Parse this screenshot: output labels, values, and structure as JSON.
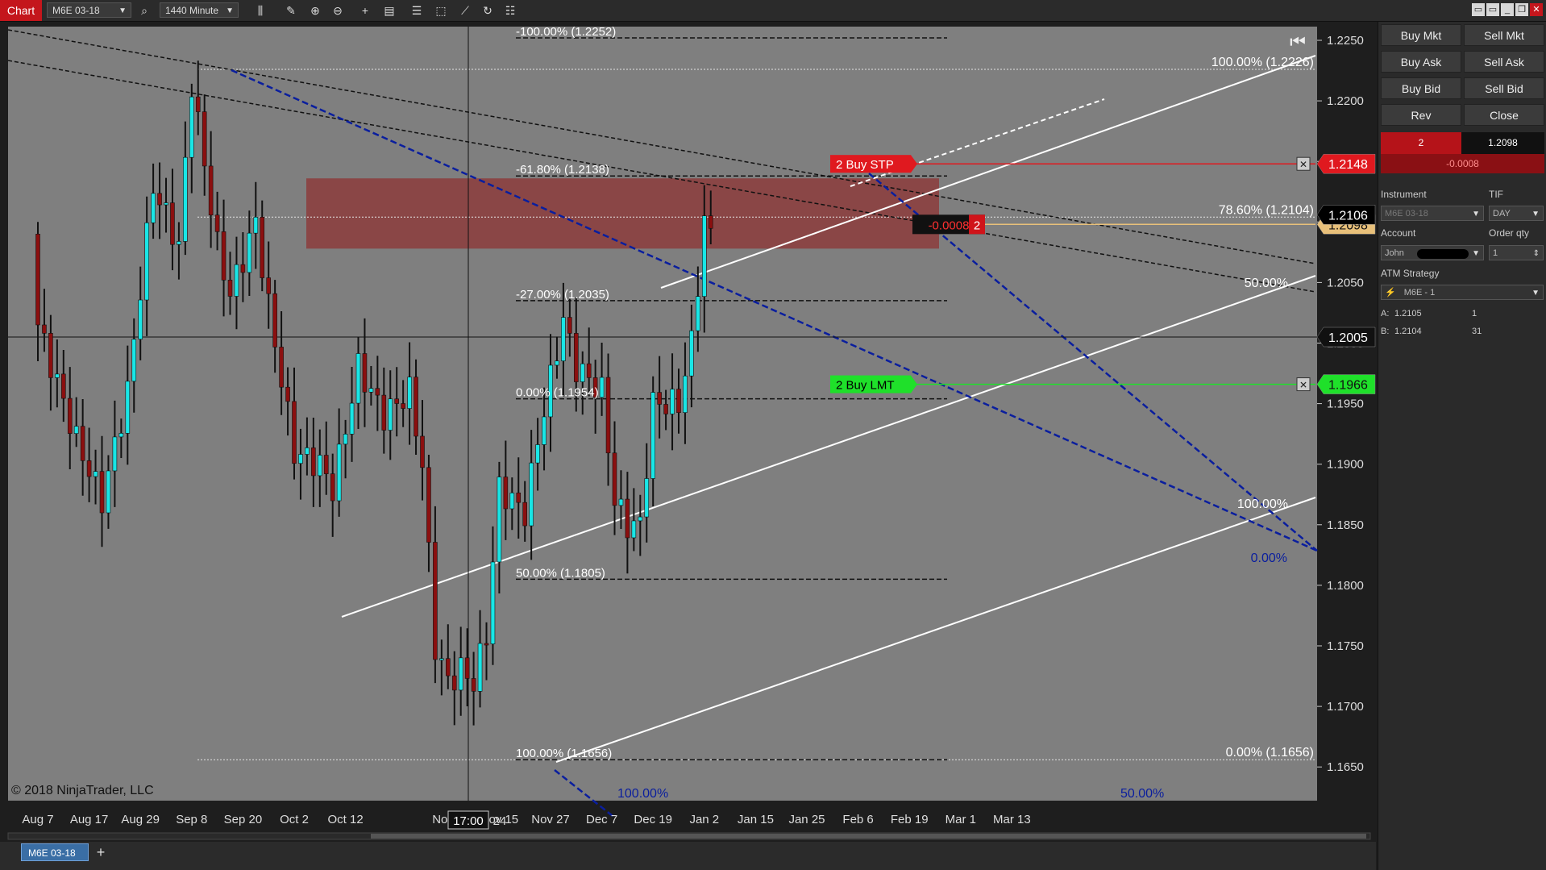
{
  "toolbar": {
    "chart_tab": "Chart",
    "instrument": "M6E 03-18",
    "interval": "1440 Minute"
  },
  "chart": {
    "copyright": "© 2018 NinjaTrader, LLC",
    "crosshair_time": "17:00",
    "crosshair_date_suffix": "24",
    "price_labels": [
      "1.2250",
      "1.2200",
      "1.2150",
      "1.2100",
      "1.2050",
      "1.2000",
      "1.1950",
      "1.1900",
      "1.1850",
      "1.1800",
      "1.1750",
      "1.1700",
      "1.1650"
    ],
    "price_values": [
      1.225,
      1.22,
      1.215,
      1.21,
      1.205,
      1.2,
      1.195,
      1.19,
      1.185,
      1.18,
      1.175,
      1.17,
      1.165
    ],
    "date_labels": [
      {
        "text": "Aug 7",
        "i": 0
      },
      {
        "text": "Aug 17",
        "i": 8
      },
      {
        "text": "Aug 29",
        "i": 16
      },
      {
        "text": "Sep 8",
        "i": 24
      },
      {
        "text": "Sep 20",
        "i": 32
      },
      {
        "text": "Oct 2",
        "i": 40
      },
      {
        "text": "Oct 12",
        "i": 48
      },
      {
        "text": "Nov 3",
        "i": 64
      },
      {
        "text": "Nov 15",
        "i": 72
      },
      {
        "text": "Nov 27",
        "i": 80
      },
      {
        "text": "Dec 7",
        "i": 88
      },
      {
        "text": "Dec 19",
        "i": 96
      },
      {
        "text": "Jan 2",
        "i": 104
      },
      {
        "text": "Jan 15",
        "i": 112
      },
      {
        "text": "Jan 25",
        "i": 120
      },
      {
        "text": "Feb 6",
        "i": 128
      },
      {
        "text": "Feb 19",
        "i": 136
      },
      {
        "text": "Mar 1",
        "i": 144
      },
      {
        "text": "Mar 13",
        "i": 152
      }
    ],
    "fib_left": [
      {
        "text": "-100.00% (1.2252)",
        "price": 1.2252
      },
      {
        "text": "-61.80% (1.2138)",
        "price": 1.2138
      },
      {
        "text": "-27.00% (1.2035)",
        "price": 1.2035
      },
      {
        "text": "0.00% (1.1954)",
        "price": 1.1954
      },
      {
        "text": "50.00% (1.1805)",
        "price": 1.1805
      },
      {
        "text": "100.00% (1.1656)",
        "price": 1.1656
      }
    ],
    "fib_right": [
      {
        "text": "100.00% (1.2226)",
        "price": 1.2226
      },
      {
        "text": "78.60% (1.2104)",
        "price": 1.2104
      },
      {
        "text": "0.00% (1.1656)",
        "price": 1.1656
      }
    ],
    "channel_labels": {
      "upper": "50.00%",
      "lower": "100.00%"
    },
    "blue_labels": {
      "zero": "0.00%",
      "hundred": "100.00%",
      "fifty": "50.00%"
    },
    "orders": {
      "stop": {
        "label": "2 Buy STP",
        "price_text": "1.2148",
        "price": 1.2148,
        "color": "#e0191f"
      },
      "limit": {
        "label": "2 Buy LMT",
        "price_text": "1.1966",
        "price": 1.1966,
        "color": "#1fe02a"
      },
      "position": {
        "pnl": "-0.0008",
        "qty": "2",
        "price": 1.2098,
        "price_text": "1.2098"
      }
    },
    "last_price": {
      "text": "1.2106",
      "price": 1.2106
    },
    "crosshair_price": {
      "text": "1.2005",
      "price": 1.2005
    },
    "colors": {
      "bg": "#7f7f7f",
      "up": "#19e6e6",
      "down": "#8b0f0f",
      "zone": "#8c3c3c",
      "blue": "#0a1e9e"
    }
  },
  "panel": {
    "buttons": [
      [
        "Buy Mkt",
        "Sell Mkt"
      ],
      [
        "Buy Ask",
        "Sell Ask"
      ],
      [
        "Buy Bid",
        "Sell Bid"
      ],
      [
        "Rev",
        "Close"
      ]
    ],
    "position_qty": "2",
    "position_price": "1.2098",
    "position_pnl": "-0.0008",
    "instrument_label": "Instrument",
    "instrument_value": "M6E 03-18",
    "tif_label": "TIF",
    "tif_value": "DAY",
    "account_label": "Account",
    "account_value": "John",
    "order_qty_label": "Order qty",
    "order_qty_value": "1",
    "atm_label": "ATM Strategy",
    "atm_value": "M6E - 1",
    "ask_label": "A:",
    "ask_price": "1.2105",
    "ask_size": "1",
    "bid_label": "B:",
    "bid_price": "1.2104",
    "bid_size": "31"
  },
  "bottom": {
    "tab": "M6E 03-18"
  }
}
